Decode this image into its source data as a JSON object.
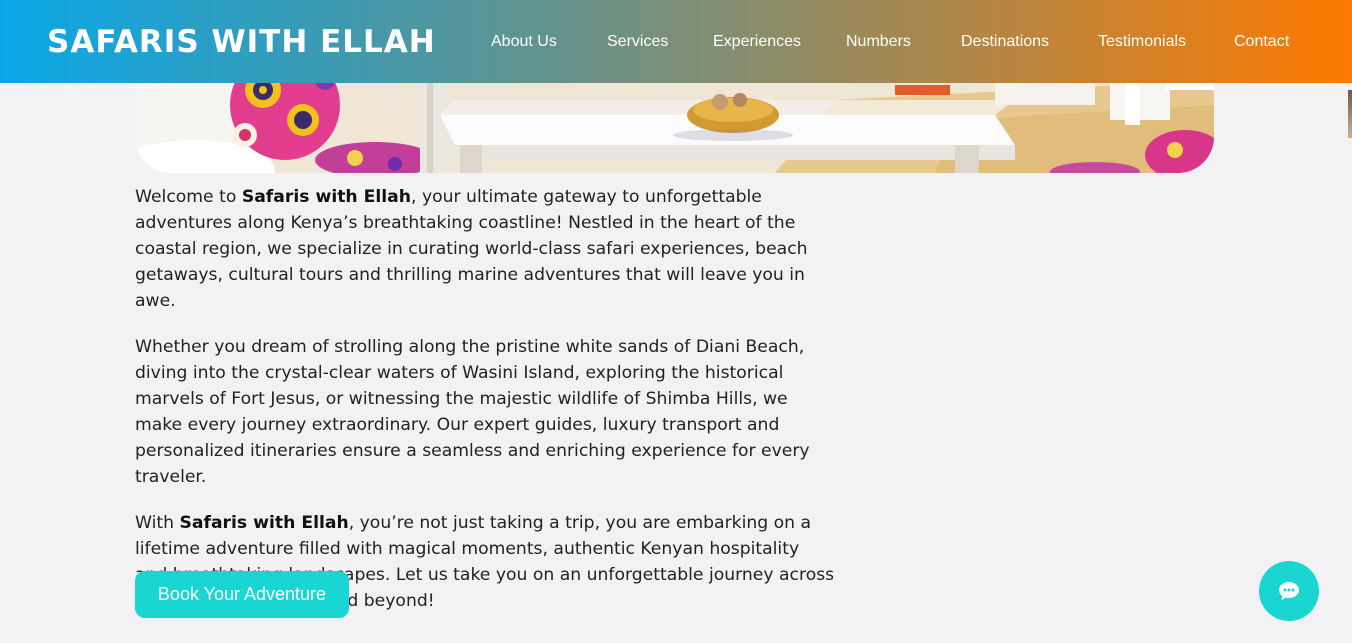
{
  "header": {
    "brand": "SAFARIS WITH ELLAH",
    "nav": [
      "About Us",
      "Services",
      "Experiences",
      "Numbers",
      "Destinations",
      "Testimonials",
      "Contact"
    ]
  },
  "about": {
    "p1_prefix": "Welcome to ",
    "p1_strong": "Safaris with Ellah",
    "p1_suffix": ", your ultimate gateway to unforgettable adventures along Kenya’s breathtaking coastline! Nestled in the heart of the coastal region, we specialize in curating world-class safari experiences, beach getaways, cultural tours and thrilling marine adventures that will leave you in awe.",
    "p2": "Whether you dream of strolling along the pristine white sands of Diani Beach, diving into the crystal-clear waters of Wasini Island, exploring the historical marvels of Fort Jesus, or witnessing the majestic wildlife of Shimba Hills, we make every journey extraordinary. Our expert guides, luxury transport and personalized itineraries ensure a seamless and enriching experience for every traveler.",
    "p3_prefix": "With ",
    "p3_strong": "Safaris with Ellah",
    "p3_suffix": ", you’re not just taking a trip, you are embarking on a lifetime adventure filled with magical moments, authentic Kenyan hospitality and breathtaking landscapes. Let us take you on an unforgettable journey across Mombasa, Diani, Kilifi and beyond!",
    "cta_label": "Book Your Adventure"
  },
  "icons": {
    "chat": "chat-bubble-icon"
  },
  "colors": {
    "header_start": "#0aa7e8",
    "header_end": "#ff7a00",
    "accent": "#19d6d3",
    "page_bg": "#f2f2f4"
  }
}
